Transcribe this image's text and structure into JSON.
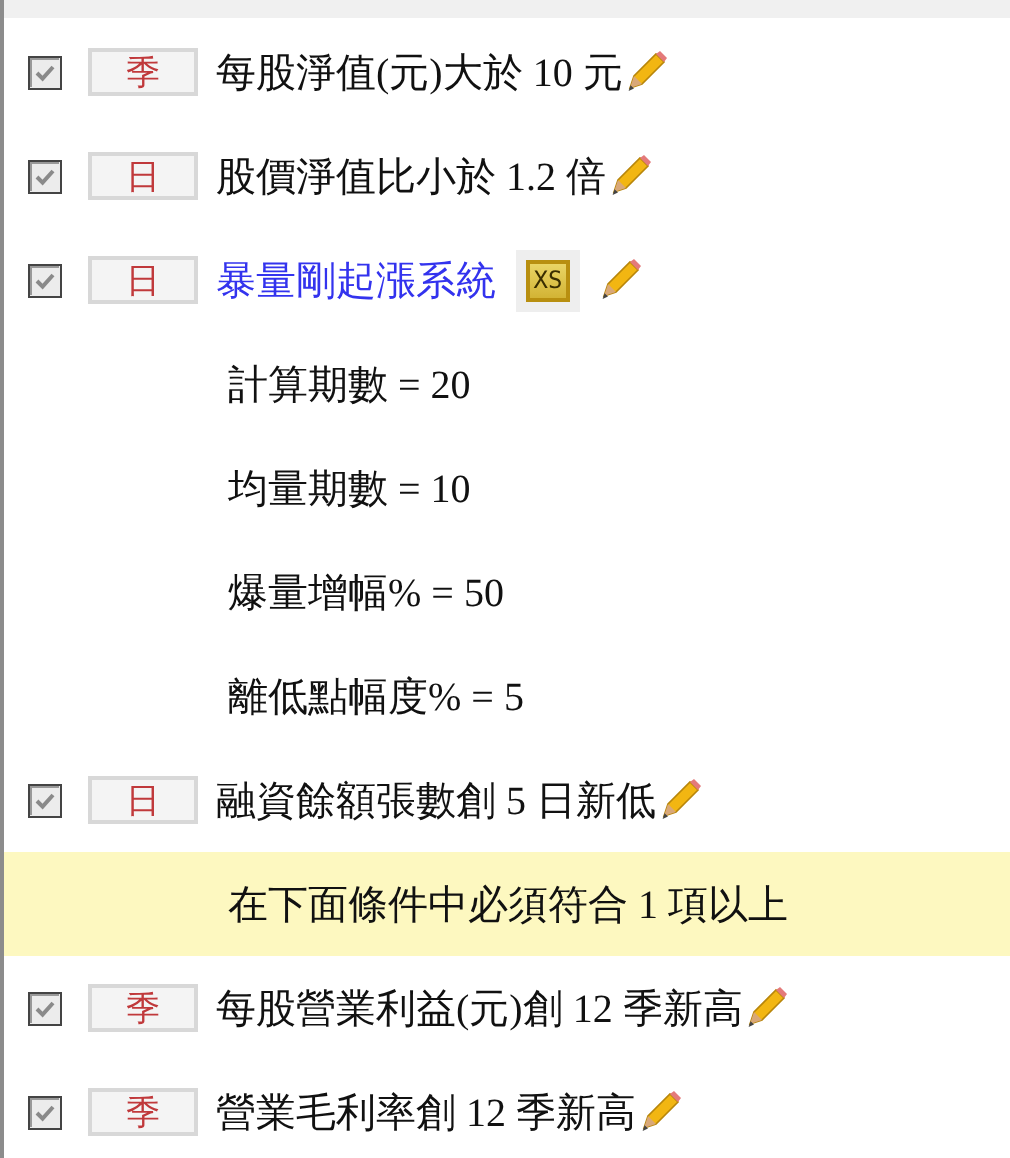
{
  "conditions": [
    {
      "kind": "condition",
      "checked": true,
      "period": "季",
      "text": "每股淨值(元)大於 10 元",
      "link": false
    },
    {
      "kind": "condition",
      "checked": true,
      "period": "日",
      "text": "股價淨值比小於 1.2 倍",
      "link": false
    },
    {
      "kind": "condition",
      "checked": true,
      "period": "日",
      "text": "暴量剛起漲系統",
      "link": true,
      "badge": "XS",
      "params": [
        "計算期數 = 20",
        "均量期數 = 10",
        "爆量增幅% = 50",
        "離低點幅度% = 5"
      ]
    },
    {
      "kind": "condition",
      "checked": true,
      "period": "日",
      "text": "融資餘額張數創 5 日新低",
      "link": false
    },
    {
      "kind": "note",
      "text": "在下面條件中必須符合 1 項以上"
    },
    {
      "kind": "condition",
      "checked": true,
      "period": "季",
      "text": "每股營業利益(元)創 12 季新高",
      "link": false
    },
    {
      "kind": "condition",
      "checked": true,
      "period": "季",
      "text": "營業毛利率創 12 季新高",
      "link": false
    }
  ]
}
